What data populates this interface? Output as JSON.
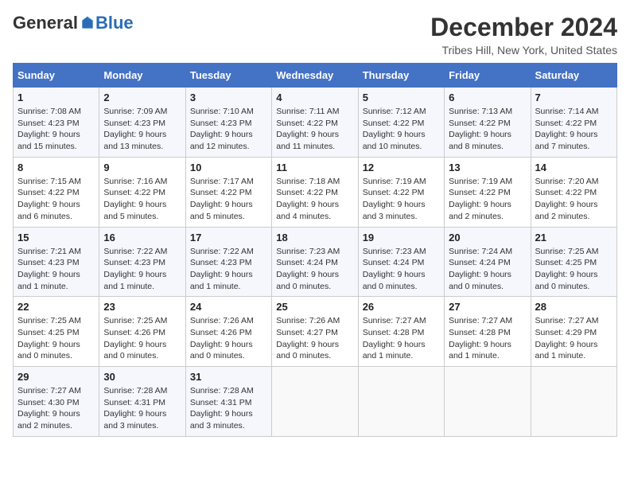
{
  "logo": {
    "general": "General",
    "blue": "Blue"
  },
  "title": "December 2024",
  "location": "Tribes Hill, New York, United States",
  "days_of_week": [
    "Sunday",
    "Monday",
    "Tuesday",
    "Wednesday",
    "Thursday",
    "Friday",
    "Saturday"
  ],
  "weeks": [
    [
      {
        "day": "1",
        "sunrise": "7:08 AM",
        "sunset": "4:23 PM",
        "daylight": "9 hours and 15 minutes."
      },
      {
        "day": "2",
        "sunrise": "7:09 AM",
        "sunset": "4:23 PM",
        "daylight": "9 hours and 13 minutes."
      },
      {
        "day": "3",
        "sunrise": "7:10 AM",
        "sunset": "4:23 PM",
        "daylight": "9 hours and 12 minutes."
      },
      {
        "day": "4",
        "sunrise": "7:11 AM",
        "sunset": "4:22 PM",
        "daylight": "9 hours and 11 minutes."
      },
      {
        "day": "5",
        "sunrise": "7:12 AM",
        "sunset": "4:22 PM",
        "daylight": "9 hours and 10 minutes."
      },
      {
        "day": "6",
        "sunrise": "7:13 AM",
        "sunset": "4:22 PM",
        "daylight": "9 hours and 8 minutes."
      },
      {
        "day": "7",
        "sunrise": "7:14 AM",
        "sunset": "4:22 PM",
        "daylight": "9 hours and 7 minutes."
      }
    ],
    [
      {
        "day": "8",
        "sunrise": "7:15 AM",
        "sunset": "4:22 PM",
        "daylight": "9 hours and 6 minutes."
      },
      {
        "day": "9",
        "sunrise": "7:16 AM",
        "sunset": "4:22 PM",
        "daylight": "9 hours and 5 minutes."
      },
      {
        "day": "10",
        "sunrise": "7:17 AM",
        "sunset": "4:22 PM",
        "daylight": "9 hours and 5 minutes."
      },
      {
        "day": "11",
        "sunrise": "7:18 AM",
        "sunset": "4:22 PM",
        "daylight": "9 hours and 4 minutes."
      },
      {
        "day": "12",
        "sunrise": "7:19 AM",
        "sunset": "4:22 PM",
        "daylight": "9 hours and 3 minutes."
      },
      {
        "day": "13",
        "sunrise": "7:19 AM",
        "sunset": "4:22 PM",
        "daylight": "9 hours and 2 minutes."
      },
      {
        "day": "14",
        "sunrise": "7:20 AM",
        "sunset": "4:22 PM",
        "daylight": "9 hours and 2 minutes."
      }
    ],
    [
      {
        "day": "15",
        "sunrise": "7:21 AM",
        "sunset": "4:23 PM",
        "daylight": "9 hours and 1 minute."
      },
      {
        "day": "16",
        "sunrise": "7:22 AM",
        "sunset": "4:23 PM",
        "daylight": "9 hours and 1 minute."
      },
      {
        "day": "17",
        "sunrise": "7:22 AM",
        "sunset": "4:23 PM",
        "daylight": "9 hours and 1 minute."
      },
      {
        "day": "18",
        "sunrise": "7:23 AM",
        "sunset": "4:24 PM",
        "daylight": "9 hours and 0 minutes."
      },
      {
        "day": "19",
        "sunrise": "7:23 AM",
        "sunset": "4:24 PM",
        "daylight": "9 hours and 0 minutes."
      },
      {
        "day": "20",
        "sunrise": "7:24 AM",
        "sunset": "4:24 PM",
        "daylight": "9 hours and 0 minutes."
      },
      {
        "day": "21",
        "sunrise": "7:25 AM",
        "sunset": "4:25 PM",
        "daylight": "9 hours and 0 minutes."
      }
    ],
    [
      {
        "day": "22",
        "sunrise": "7:25 AM",
        "sunset": "4:25 PM",
        "daylight": "9 hours and 0 minutes."
      },
      {
        "day": "23",
        "sunrise": "7:25 AM",
        "sunset": "4:26 PM",
        "daylight": "9 hours and 0 minutes."
      },
      {
        "day": "24",
        "sunrise": "7:26 AM",
        "sunset": "4:26 PM",
        "daylight": "9 hours and 0 minutes."
      },
      {
        "day": "25",
        "sunrise": "7:26 AM",
        "sunset": "4:27 PM",
        "daylight": "9 hours and 0 minutes."
      },
      {
        "day": "26",
        "sunrise": "7:27 AM",
        "sunset": "4:28 PM",
        "daylight": "9 hours and 1 minute."
      },
      {
        "day": "27",
        "sunrise": "7:27 AM",
        "sunset": "4:28 PM",
        "daylight": "9 hours and 1 minute."
      },
      {
        "day": "28",
        "sunrise": "7:27 AM",
        "sunset": "4:29 PM",
        "daylight": "9 hours and 1 minute."
      }
    ],
    [
      {
        "day": "29",
        "sunrise": "7:27 AM",
        "sunset": "4:30 PM",
        "daylight": "9 hours and 2 minutes."
      },
      {
        "day": "30",
        "sunrise": "7:28 AM",
        "sunset": "4:31 PM",
        "daylight": "9 hours and 3 minutes."
      },
      {
        "day": "31",
        "sunrise": "7:28 AM",
        "sunset": "4:31 PM",
        "daylight": "9 hours and 3 minutes."
      },
      null,
      null,
      null,
      null
    ]
  ]
}
